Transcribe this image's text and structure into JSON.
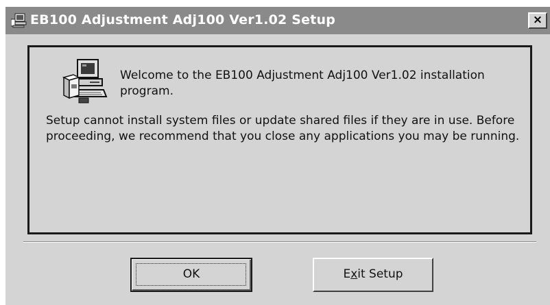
{
  "window": {
    "title": "EB100 Adjustment Adj100 Ver1.02 Setup",
    "close_label": "×",
    "title_bar_color": "#8a8a8a",
    "face_color": "#d4d4d4"
  },
  "content": {
    "welcome_text": "Welcome to the EB100 Adjustment Adj100 Ver1.02 installation program.",
    "body_text": "Setup cannot install system files or update shared files if they are in use. Before proceeding, we recommend that you close any applications you may be running.",
    "icon": "setup-computer-icon"
  },
  "buttons": {
    "ok_label": "OK",
    "exit_label_pre": "E",
    "exit_label_mnemonic": "x",
    "exit_label_post": "it Setup"
  }
}
